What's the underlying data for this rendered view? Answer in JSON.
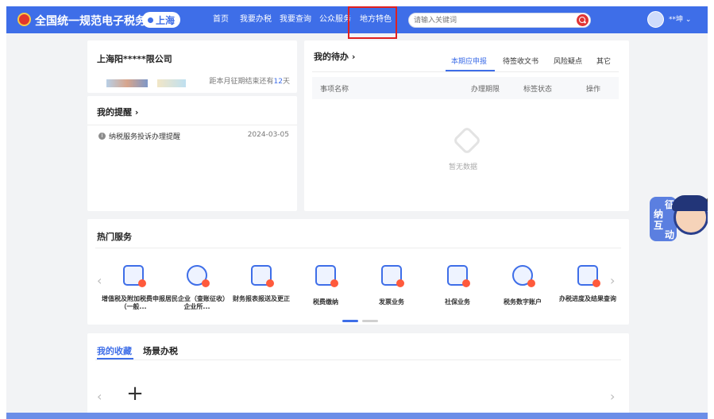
{
  "header": {
    "site_title": "全国统一规范电子税务局",
    "region": "上海",
    "nav": [
      "首页",
      "我要办税",
      "我要查询",
      "公众服务",
      "地方特色"
    ],
    "search_placeholder": "请输入关键词",
    "user_name": "**坤 ⌄"
  },
  "company": {
    "name": "上海阳*****限公司",
    "deadline_prefix": "距本月征期结束还有",
    "deadline_days": "12",
    "deadline_suffix": "天"
  },
  "reminders": {
    "title": "我的提醒 ›",
    "items": [
      {
        "text": "纳税服务投诉办理提醒",
        "date": "2024-03-05"
      }
    ]
  },
  "todo": {
    "title": "我的待办 ›",
    "tabs": [
      "本期应申报",
      "待签收文书",
      "风险疑点",
      "其它"
    ],
    "columns": [
      "事项名称",
      "办理期限",
      "标签状态",
      "操作"
    ],
    "empty_text": "暂无数据"
  },
  "hot_services": {
    "title": "热门服务",
    "items": [
      {
        "label": "增值税及附加税费申报（一般...",
        "icon": "invoice-icon"
      },
      {
        "label": "居民企业（查账征收）企业所...",
        "icon": "enterprise-icon"
      },
      {
        "label": "财务报表报送及更正",
        "icon": "report-icon"
      },
      {
        "label": "税费缴纳",
        "icon": "payment-icon"
      },
      {
        "label": "发票业务",
        "icon": "receipt-icon"
      },
      {
        "label": "社保业务",
        "icon": "social-security-icon"
      },
      {
        "label": "税务数字账户",
        "icon": "digital-account-icon"
      },
      {
        "label": "办税进度及结果查询",
        "icon": "progress-query-icon"
      }
    ],
    "page": 1,
    "pages": 2
  },
  "favorites": {
    "tabs": [
      "我的收藏",
      "场景办税"
    ],
    "add": "+"
  },
  "mascot": {
    "chars": [
      "征",
      "纳",
      "互",
      "动"
    ]
  },
  "colors": {
    "brand": "#3e6ee8",
    "highlight": "#e02020"
  }
}
